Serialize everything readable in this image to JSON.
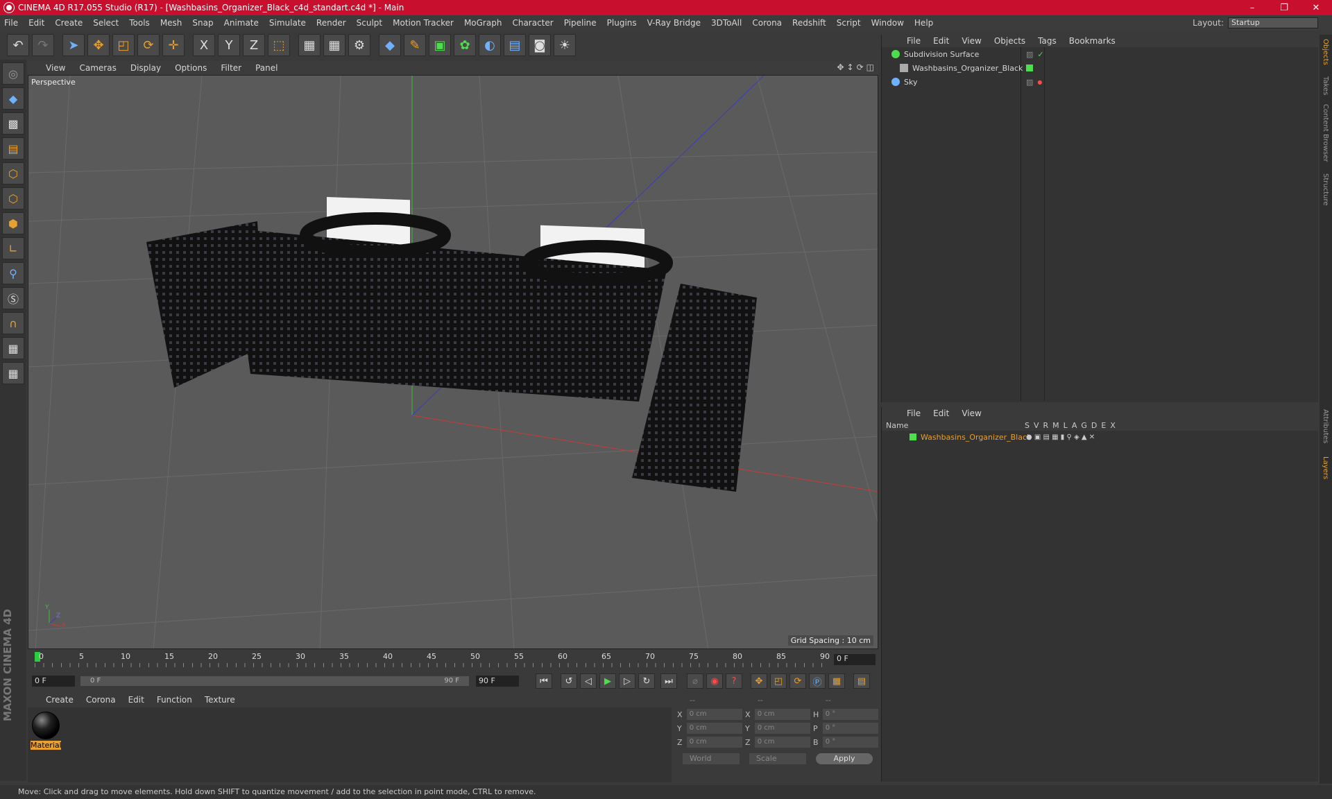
{
  "window": {
    "title": "CINEMA 4D R17.055 Studio (R17) - [Washbasins_Organizer_Black_c4d_standart.c4d *] - Main",
    "controls": [
      "–",
      "❐",
      "✕"
    ]
  },
  "menubar": {
    "items": [
      "File",
      "Edit",
      "Create",
      "Select",
      "Tools",
      "Mesh",
      "Snap",
      "Animate",
      "Simulate",
      "Render",
      "Sculpt",
      "Motion Tracker",
      "MoGraph",
      "Character",
      "Pipeline",
      "Plugins",
      "V-Ray Bridge",
      "3DToAll",
      "Corona",
      "Redshift",
      "Script",
      "Window",
      "Help"
    ],
    "layout_label": "Layout:",
    "layout_value": "Startup"
  },
  "toolbar": {
    "icons": [
      "undo-icon",
      "redo-icon",
      "select-icon",
      "move-icon",
      "scale-icon",
      "rotate-icon",
      "transform-icon",
      "x-axis-icon",
      "y-axis-icon",
      "z-axis-icon",
      "world-coords-icon",
      "render-view-icon",
      "render-picture-icon",
      "render-settings-icon",
      "cube-icon",
      "pen-icon",
      "subdivision-icon",
      "cloner-icon",
      "deformer-icon",
      "floor-icon",
      "camera-icon",
      "light-icon"
    ],
    "axis_labels": [
      "X",
      "Y",
      "Z"
    ]
  },
  "viewport": {
    "menu": [
      "View",
      "Cameras",
      "Display",
      "Options",
      "Filter",
      "Panel"
    ],
    "label": "Perspective",
    "grid_spacing": "Grid Spacing : 10 cm",
    "axis_x": "X",
    "axis_y": "Y",
    "axis_z": "Z"
  },
  "timeline": {
    "ticks": [
      "0",
      "5",
      "10",
      "15",
      "20",
      "25",
      "30",
      "35",
      "40",
      "45",
      "50",
      "55",
      "60",
      "65",
      "70",
      "75",
      "80",
      "85",
      "90"
    ],
    "current": "0 F"
  },
  "playbar": {
    "start": "0 F",
    "slider_start": "0 F",
    "slider_end": "90 F",
    "end": "90 F"
  },
  "material_panel": {
    "menu": [
      "Create",
      "Corona",
      "Edit",
      "Function",
      "Texture"
    ],
    "material_name": "Material"
  },
  "coords": {
    "headers": [
      "--",
      "--",
      "--"
    ],
    "rows": [
      {
        "a": "X",
        "v1": "0 cm",
        "b": "X",
        "v2": "0 cm",
        "c": "H",
        "v3": "0 °"
      },
      {
        "a": "Y",
        "v1": "0 cm",
        "b": "Y",
        "v2": "0 cm",
        "c": "P",
        "v3": "0 °"
      },
      {
        "a": "Z",
        "v1": "0 cm",
        "b": "Z",
        "v2": "0 cm",
        "c": "B",
        "v3": "0 °"
      }
    ],
    "world": "World",
    "scale": "Scale",
    "apply": "Apply"
  },
  "objects_panel": {
    "menu": [
      "File",
      "Edit",
      "View",
      "Objects",
      "Tags",
      "Bookmarks"
    ],
    "items": [
      {
        "name": "Subdivision Surface",
        "color": "#4be04b"
      },
      {
        "name": "Washbasins_Organizer_Black",
        "color": "#aaaaaa"
      },
      {
        "name": "Sky",
        "color": "#6fb1ff"
      }
    ]
  },
  "layers_panel": {
    "menu": [
      "File",
      "Edit",
      "View"
    ],
    "header_name": "Name",
    "columns": [
      "S",
      "V",
      "R",
      "M",
      "L",
      "A",
      "G",
      "D",
      "E",
      "X"
    ],
    "layer_name": "Washbasins_Organizer_Black",
    "layer_color": "#4be04b"
  },
  "side_tabs": [
    "Objects",
    "Takes",
    "Content Browser",
    "Structure",
    "Attributes",
    "Layers"
  ],
  "status": "Move: Click and drag to move elements. Hold down SHIFT to quantize movement / add to the selection in point mode, CTRL to remove.",
  "brand": "MAXON CINEMA 4D"
}
